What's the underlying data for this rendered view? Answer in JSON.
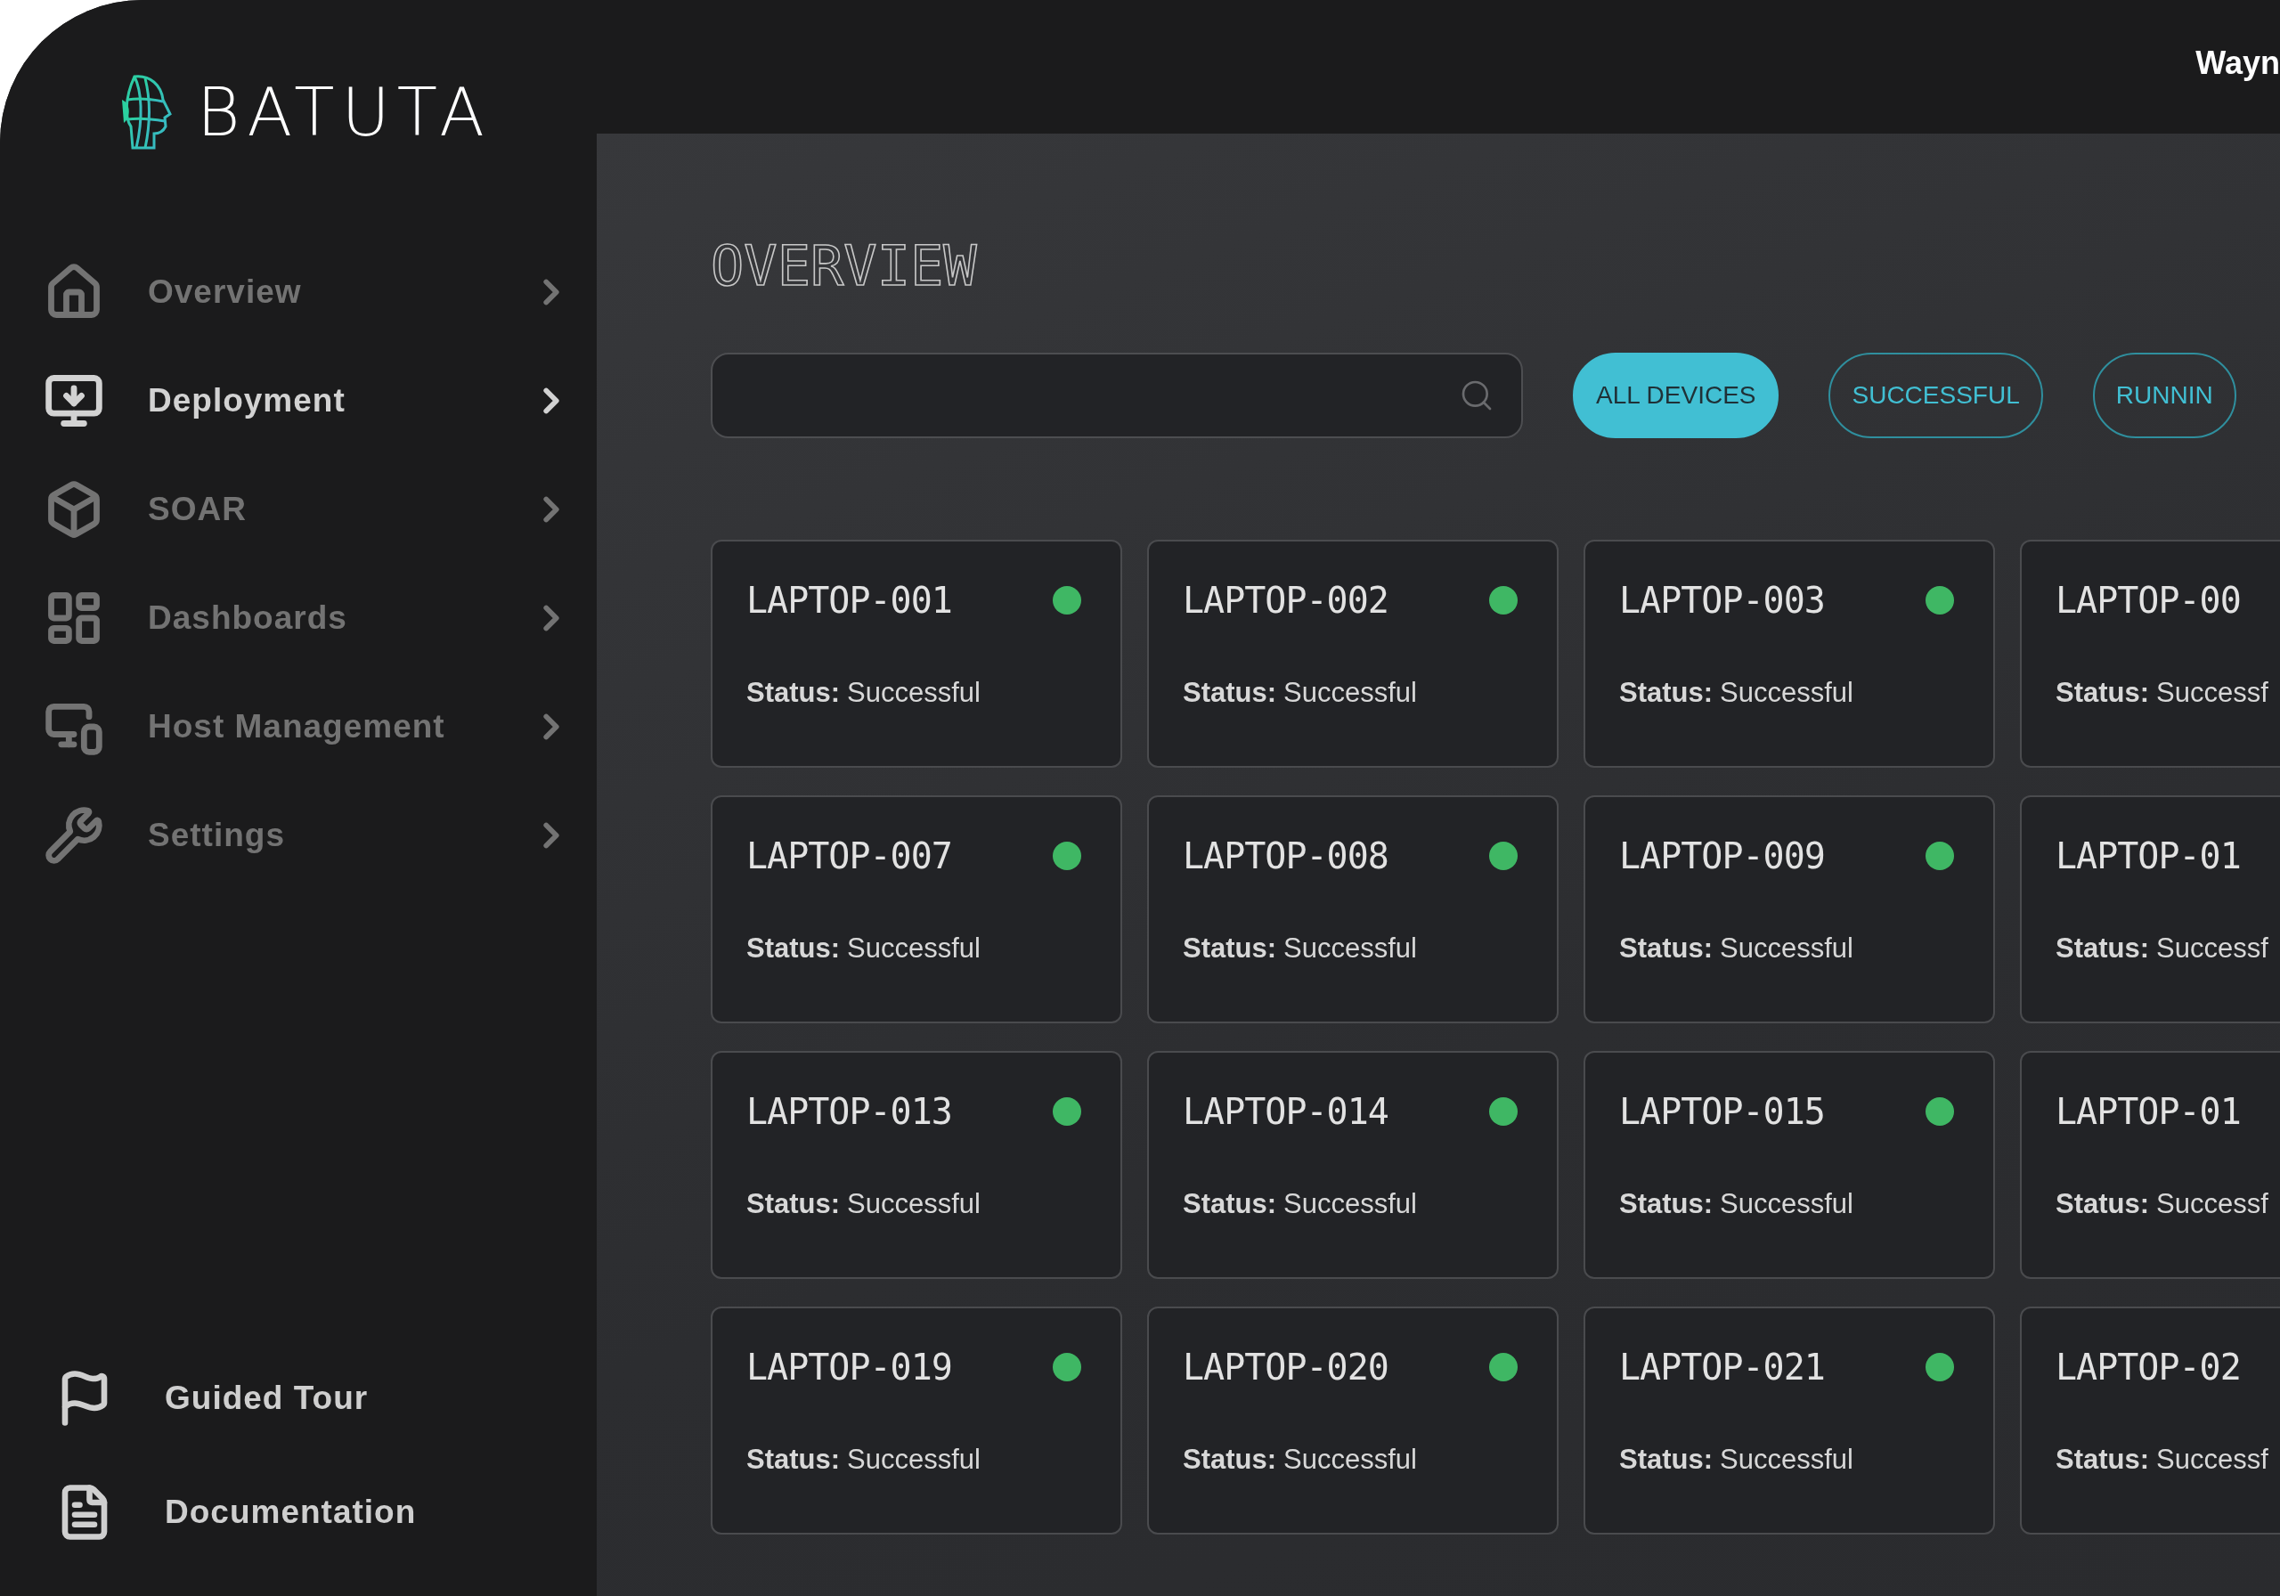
{
  "brand": {
    "name": "BATUTA"
  },
  "sidebar": {
    "items": [
      {
        "label": "Overview",
        "selected": false
      },
      {
        "label": "Deployment",
        "selected": true
      },
      {
        "label": "SOAR",
        "selected": false
      },
      {
        "label": "Dashboards",
        "selected": false
      },
      {
        "label": "Host Management",
        "selected": false
      },
      {
        "label": "Settings",
        "selected": false
      }
    ],
    "footer_items": [
      {
        "label": "Guided Tour"
      },
      {
        "label": "Documentation"
      }
    ]
  },
  "top_bar": {
    "user": "Wayn"
  },
  "page": {
    "title": "OVERVIEW",
    "filters": [
      {
        "label": "ALL DEVICES",
        "selected": true
      },
      {
        "label": "SUCCESSFUL",
        "selected": false
      },
      {
        "label": "RUNNIN",
        "selected": false
      }
    ],
    "devices": [
      {
        "name": "LAPTOP-001",
        "status_label": "Status:",
        "status": "Successful",
        "color": "#3fb764"
      },
      {
        "name": "LAPTOP-002",
        "status_label": "Status:",
        "status": "Successful",
        "color": "#3fb764"
      },
      {
        "name": "LAPTOP-003",
        "status_label": "Status:",
        "status": "Successful",
        "color": "#3fb764"
      },
      {
        "name": "LAPTOP-00",
        "status_label": "Status:",
        "status": "Successf"
      },
      {
        "name": "LAPTOP-007",
        "status_label": "Status:",
        "status": "Successful",
        "color": "#3fb764"
      },
      {
        "name": "LAPTOP-008",
        "status_label": "Status:",
        "status": "Successful",
        "color": "#3fb764"
      },
      {
        "name": "LAPTOP-009",
        "status_label": "Status:",
        "status": "Successful",
        "color": "#3fb764"
      },
      {
        "name": "LAPTOP-01",
        "status_label": "Status:",
        "status": "Successf"
      },
      {
        "name": "LAPTOP-013",
        "status_label": "Status:",
        "status": "Successful",
        "color": "#3fb764"
      },
      {
        "name": "LAPTOP-014",
        "status_label": "Status:",
        "status": "Successful",
        "color": "#3fb764"
      },
      {
        "name": "LAPTOP-015",
        "status_label": "Status:",
        "status": "Successful",
        "color": "#3fb764"
      },
      {
        "name": "LAPTOP-01",
        "status_label": "Status:",
        "status": "Successf"
      },
      {
        "name": "LAPTOP-019",
        "status_label": "Status:",
        "status": "Successful",
        "color": "#3fb764"
      },
      {
        "name": "LAPTOP-020",
        "status_label": "Status:",
        "status": "Successful",
        "color": "#3fb764"
      },
      {
        "name": "LAPTOP-021",
        "status_label": "Status:",
        "status": "Successful",
        "color": "#3fb764"
      },
      {
        "name": "LAPTOP-02",
        "status_label": "Status:",
        "status": "Successf"
      }
    ]
  }
}
